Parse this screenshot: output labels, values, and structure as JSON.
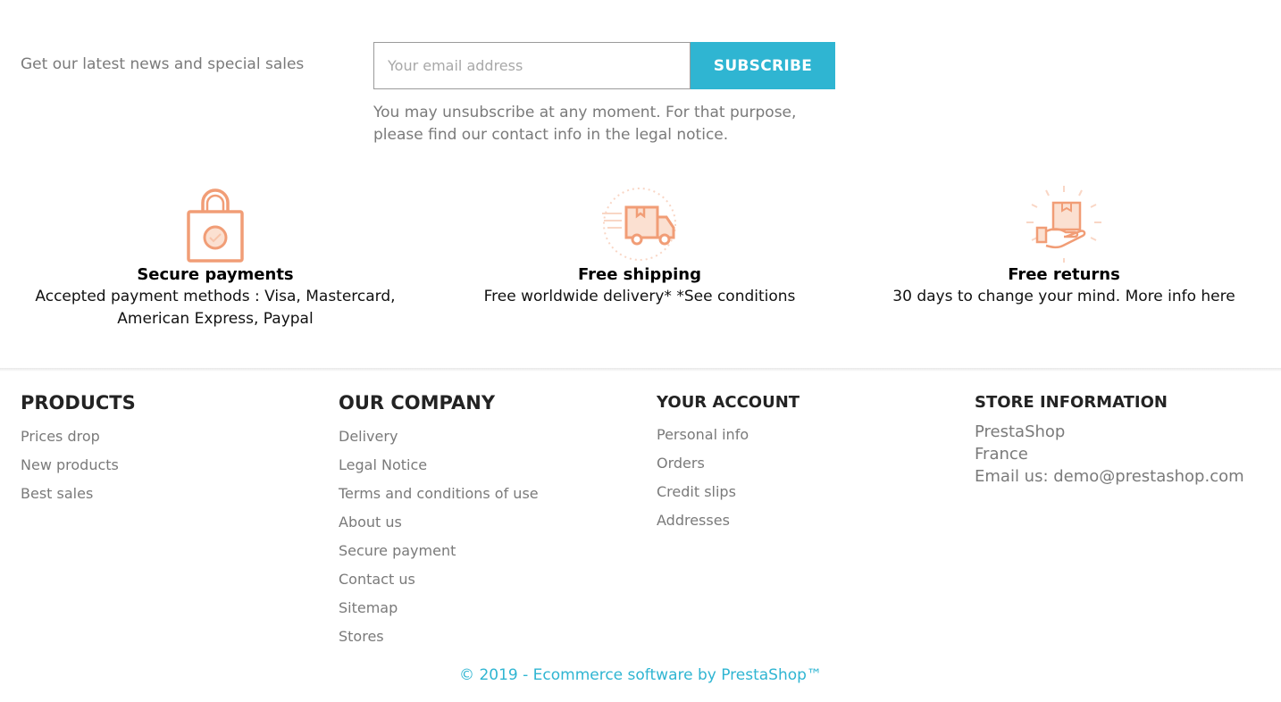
{
  "newsletter": {
    "label": "Get our latest news and special sales",
    "email_placeholder": "Your email address",
    "subscribe_label": "SUBSCRIBE",
    "note": "You may unsubscribe at any moment. For that purpose, please find our contact info in the legal notice."
  },
  "reassurance": [
    {
      "icon": "padlock-icon",
      "title": "Secure payments",
      "description": "Accepted payment methods : Visa, Mastercard, American Express, Paypal"
    },
    {
      "icon": "delivery-truck-icon",
      "title": "Free shipping",
      "description": "Free worldwide delivery* *See conditions"
    },
    {
      "icon": "box-in-hand-icon",
      "title": "Free returns",
      "description": "30 days to change your mind. More info here"
    }
  ],
  "footer": {
    "products": {
      "title": "PRODUCTS",
      "links": [
        "Prices drop",
        "New products",
        "Best sales"
      ]
    },
    "company": {
      "title": "OUR COMPANY",
      "links": [
        "Delivery",
        "Legal Notice",
        "Terms and conditions of use",
        "About us",
        "Secure payment",
        "Contact us",
        "Sitemap",
        "Stores"
      ]
    },
    "account": {
      "title": "YOUR ACCOUNT",
      "links": [
        "Personal info",
        "Orders",
        "Credit slips",
        "Addresses"
      ]
    },
    "store": {
      "title": "STORE INFORMATION",
      "name": "PrestaShop",
      "country": "France",
      "email": "Email us: demo@prestashop.com"
    },
    "copyright": "© 2019 - Ecommerce software by PrestaShop™"
  },
  "colors": {
    "accent": "#2fb5d2",
    "icon": "#f19d76",
    "text_muted": "#7a7a7a",
    "heading": "#232323"
  }
}
